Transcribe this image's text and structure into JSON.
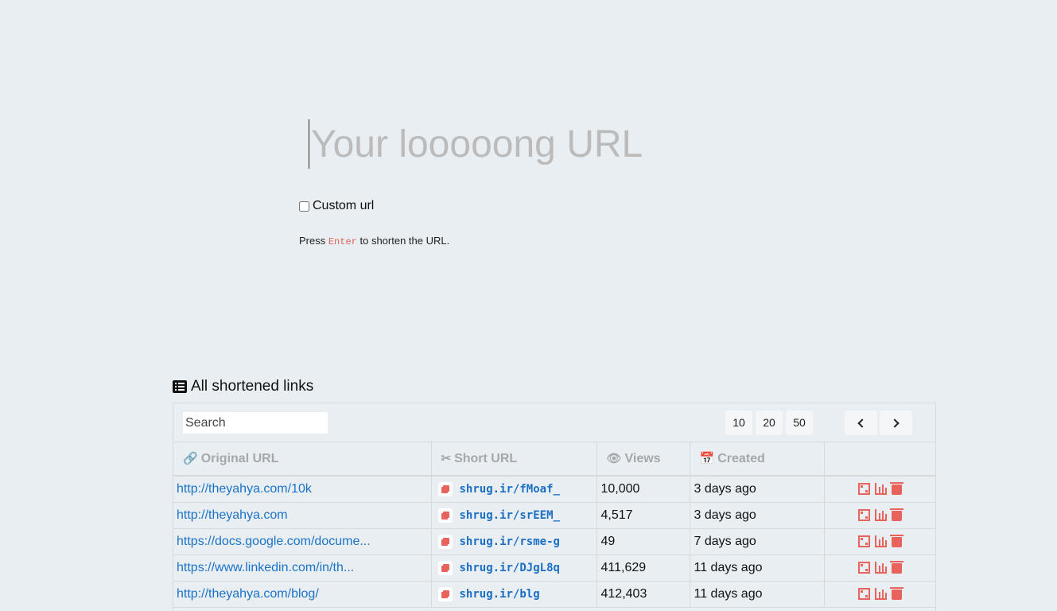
{
  "url_input": {
    "placeholder": "Your looooong URL"
  },
  "custom_url": {
    "label": "Custom url",
    "checked": false
  },
  "hint": {
    "prefix": "Press",
    "key": "Enter",
    "suffix": "to shorten the URL."
  },
  "section": {
    "title": "All shortened links"
  },
  "toolbar": {
    "search_placeholder": "Search",
    "page_sizes": [
      "10",
      "20",
      "50"
    ]
  },
  "table": {
    "headers": {
      "original": "Original URL",
      "short": "Short URL",
      "views": "Views",
      "created": "Created"
    },
    "rows": [
      {
        "original": "http://theyahya.com/10k",
        "short": "shrug.ir/fMoaf_",
        "views": "10,000",
        "created": "3 days ago"
      },
      {
        "original": "http://theyahya.com",
        "short": "shrug.ir/srEEM_",
        "views": "4,517",
        "created": "3 days ago"
      },
      {
        "original": "https://docs.google.com/docume...",
        "short": "shrug.ir/rsme-g",
        "views": "49",
        "created": "7 days ago"
      },
      {
        "original": "https://www.linkedin.com/in/th...",
        "short": "shrug.ir/DJgL8q",
        "views": "411,629",
        "created": "11 days ago"
      },
      {
        "original": "http://theyahya.com/blog/",
        "short": "shrug.ir/blg",
        "views": "412,403",
        "created": "11 days ago"
      }
    ]
  },
  "icons": {
    "link": "link-icon",
    "scissors": "scissors-icon",
    "eye": "eye-icon",
    "calendar": "calendar-icon",
    "copy": "copy-icon",
    "qr": "qrcode-icon",
    "stats": "bar-chart-icon",
    "delete": "trash-icon"
  },
  "colors": {
    "background": "#e9eef2",
    "link": "#1a73c8",
    "accent": "#e8635b",
    "header_text": "#a4a8ab"
  }
}
